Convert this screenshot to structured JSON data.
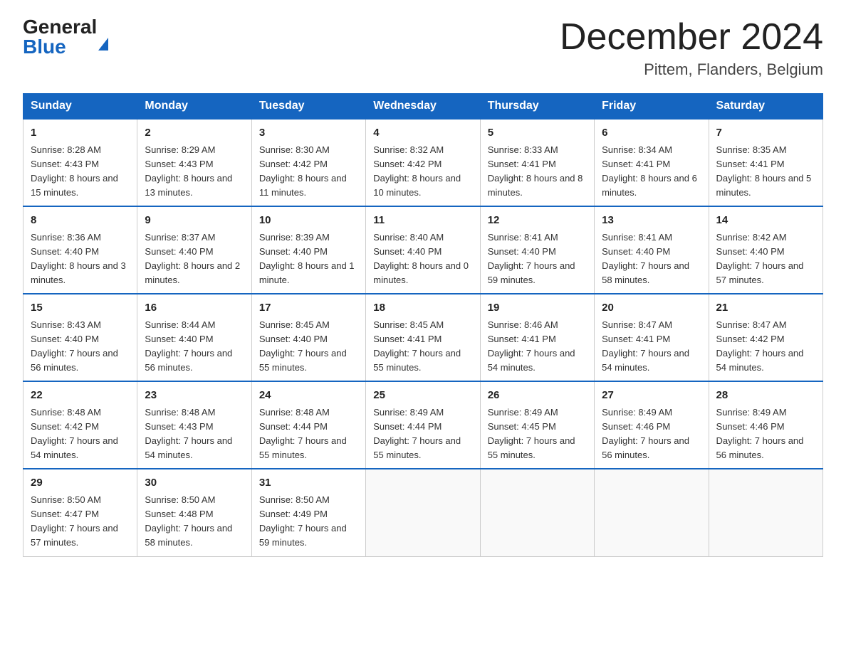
{
  "header": {
    "logo_general": "General",
    "logo_blue": "Blue",
    "month_title": "December 2024",
    "location": "Pittem, Flanders, Belgium"
  },
  "days_of_week": [
    "Sunday",
    "Monday",
    "Tuesday",
    "Wednesday",
    "Thursday",
    "Friday",
    "Saturday"
  ],
  "weeks": [
    [
      {
        "day": "1",
        "sunrise": "8:28 AM",
        "sunset": "4:43 PM",
        "daylight": "8 hours and 15 minutes."
      },
      {
        "day": "2",
        "sunrise": "8:29 AM",
        "sunset": "4:43 PM",
        "daylight": "8 hours and 13 minutes."
      },
      {
        "day": "3",
        "sunrise": "8:30 AM",
        "sunset": "4:42 PM",
        "daylight": "8 hours and 11 minutes."
      },
      {
        "day": "4",
        "sunrise": "8:32 AM",
        "sunset": "4:42 PM",
        "daylight": "8 hours and 10 minutes."
      },
      {
        "day": "5",
        "sunrise": "8:33 AM",
        "sunset": "4:41 PM",
        "daylight": "8 hours and 8 minutes."
      },
      {
        "day": "6",
        "sunrise": "8:34 AM",
        "sunset": "4:41 PM",
        "daylight": "8 hours and 6 minutes."
      },
      {
        "day": "7",
        "sunrise": "8:35 AM",
        "sunset": "4:41 PM",
        "daylight": "8 hours and 5 minutes."
      }
    ],
    [
      {
        "day": "8",
        "sunrise": "8:36 AM",
        "sunset": "4:40 PM",
        "daylight": "8 hours and 3 minutes."
      },
      {
        "day": "9",
        "sunrise": "8:37 AM",
        "sunset": "4:40 PM",
        "daylight": "8 hours and 2 minutes."
      },
      {
        "day": "10",
        "sunrise": "8:39 AM",
        "sunset": "4:40 PM",
        "daylight": "8 hours and 1 minute."
      },
      {
        "day": "11",
        "sunrise": "8:40 AM",
        "sunset": "4:40 PM",
        "daylight": "8 hours and 0 minutes."
      },
      {
        "day": "12",
        "sunrise": "8:41 AM",
        "sunset": "4:40 PM",
        "daylight": "7 hours and 59 minutes."
      },
      {
        "day": "13",
        "sunrise": "8:41 AM",
        "sunset": "4:40 PM",
        "daylight": "7 hours and 58 minutes."
      },
      {
        "day": "14",
        "sunrise": "8:42 AM",
        "sunset": "4:40 PM",
        "daylight": "7 hours and 57 minutes."
      }
    ],
    [
      {
        "day": "15",
        "sunrise": "8:43 AM",
        "sunset": "4:40 PM",
        "daylight": "7 hours and 56 minutes."
      },
      {
        "day": "16",
        "sunrise": "8:44 AM",
        "sunset": "4:40 PM",
        "daylight": "7 hours and 56 minutes."
      },
      {
        "day": "17",
        "sunrise": "8:45 AM",
        "sunset": "4:40 PM",
        "daylight": "7 hours and 55 minutes."
      },
      {
        "day": "18",
        "sunrise": "8:45 AM",
        "sunset": "4:41 PM",
        "daylight": "7 hours and 55 minutes."
      },
      {
        "day": "19",
        "sunrise": "8:46 AM",
        "sunset": "4:41 PM",
        "daylight": "7 hours and 54 minutes."
      },
      {
        "day": "20",
        "sunrise": "8:47 AM",
        "sunset": "4:41 PM",
        "daylight": "7 hours and 54 minutes."
      },
      {
        "day": "21",
        "sunrise": "8:47 AM",
        "sunset": "4:42 PM",
        "daylight": "7 hours and 54 minutes."
      }
    ],
    [
      {
        "day": "22",
        "sunrise": "8:48 AM",
        "sunset": "4:42 PM",
        "daylight": "7 hours and 54 minutes."
      },
      {
        "day": "23",
        "sunrise": "8:48 AM",
        "sunset": "4:43 PM",
        "daylight": "7 hours and 54 minutes."
      },
      {
        "day": "24",
        "sunrise": "8:48 AM",
        "sunset": "4:44 PM",
        "daylight": "7 hours and 55 minutes."
      },
      {
        "day": "25",
        "sunrise": "8:49 AM",
        "sunset": "4:44 PM",
        "daylight": "7 hours and 55 minutes."
      },
      {
        "day": "26",
        "sunrise": "8:49 AM",
        "sunset": "4:45 PM",
        "daylight": "7 hours and 55 minutes."
      },
      {
        "day": "27",
        "sunrise": "8:49 AM",
        "sunset": "4:46 PM",
        "daylight": "7 hours and 56 minutes."
      },
      {
        "day": "28",
        "sunrise": "8:49 AM",
        "sunset": "4:46 PM",
        "daylight": "7 hours and 56 minutes."
      }
    ],
    [
      {
        "day": "29",
        "sunrise": "8:50 AM",
        "sunset": "4:47 PM",
        "daylight": "7 hours and 57 minutes."
      },
      {
        "day": "30",
        "sunrise": "8:50 AM",
        "sunset": "4:48 PM",
        "daylight": "7 hours and 58 minutes."
      },
      {
        "day": "31",
        "sunrise": "8:50 AM",
        "sunset": "4:49 PM",
        "daylight": "7 hours and 59 minutes."
      },
      null,
      null,
      null,
      null
    ]
  ]
}
